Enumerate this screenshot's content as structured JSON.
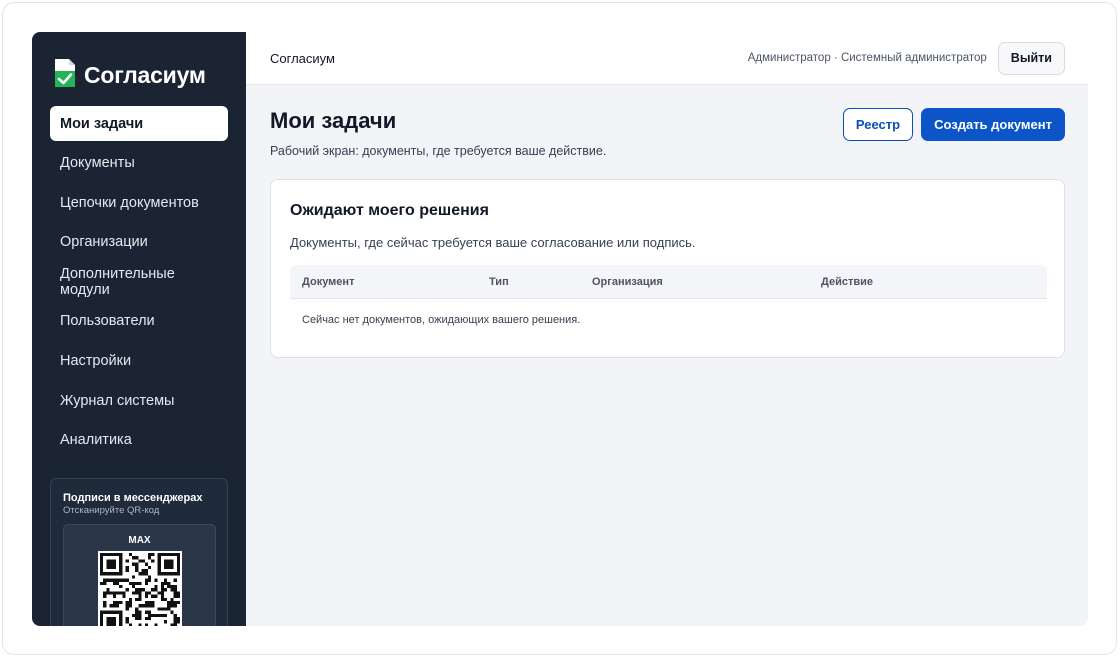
{
  "brand": {
    "name": "Согласиум",
    "icon": "document-check-icon"
  },
  "sidebar": {
    "items": [
      {
        "label": "Мои задачи",
        "active": true
      },
      {
        "label": "Документы"
      },
      {
        "label": "Цепочки документов"
      },
      {
        "label": "Организации"
      },
      {
        "label": "Дополнительные модули"
      },
      {
        "label": "Пользователи"
      },
      {
        "label": "Настройки"
      },
      {
        "label": "Журнал системы"
      },
      {
        "label": "Аналитика"
      }
    ],
    "promo": {
      "title": "Подписи в мессенджерах",
      "subtitle": "Отсканируйте QR-код",
      "qr_label": "MAX"
    }
  },
  "topbar": {
    "title": "Согласиум",
    "user": "Администратор · Системный администратор",
    "logout_label": "Выйти"
  },
  "page": {
    "title": "Мои задачи",
    "subtitle": "Рабочий экран: документы, где требуется ваше действие.",
    "registry_label": "Реестр",
    "create_label": "Создать документ"
  },
  "card": {
    "title": "Ожидают моего решения",
    "description": "Документы, где сейчас требуется ваше согласование или подпись.",
    "columns": [
      "Документ",
      "Тип",
      "Организация",
      "Действие"
    ],
    "empty_text": "Сейчас нет документов, ожидающих вашего решения."
  },
  "colors": {
    "sidebar_bg": "#1a2433",
    "primary": "#0b55c9",
    "accent_check": "#22b457"
  }
}
